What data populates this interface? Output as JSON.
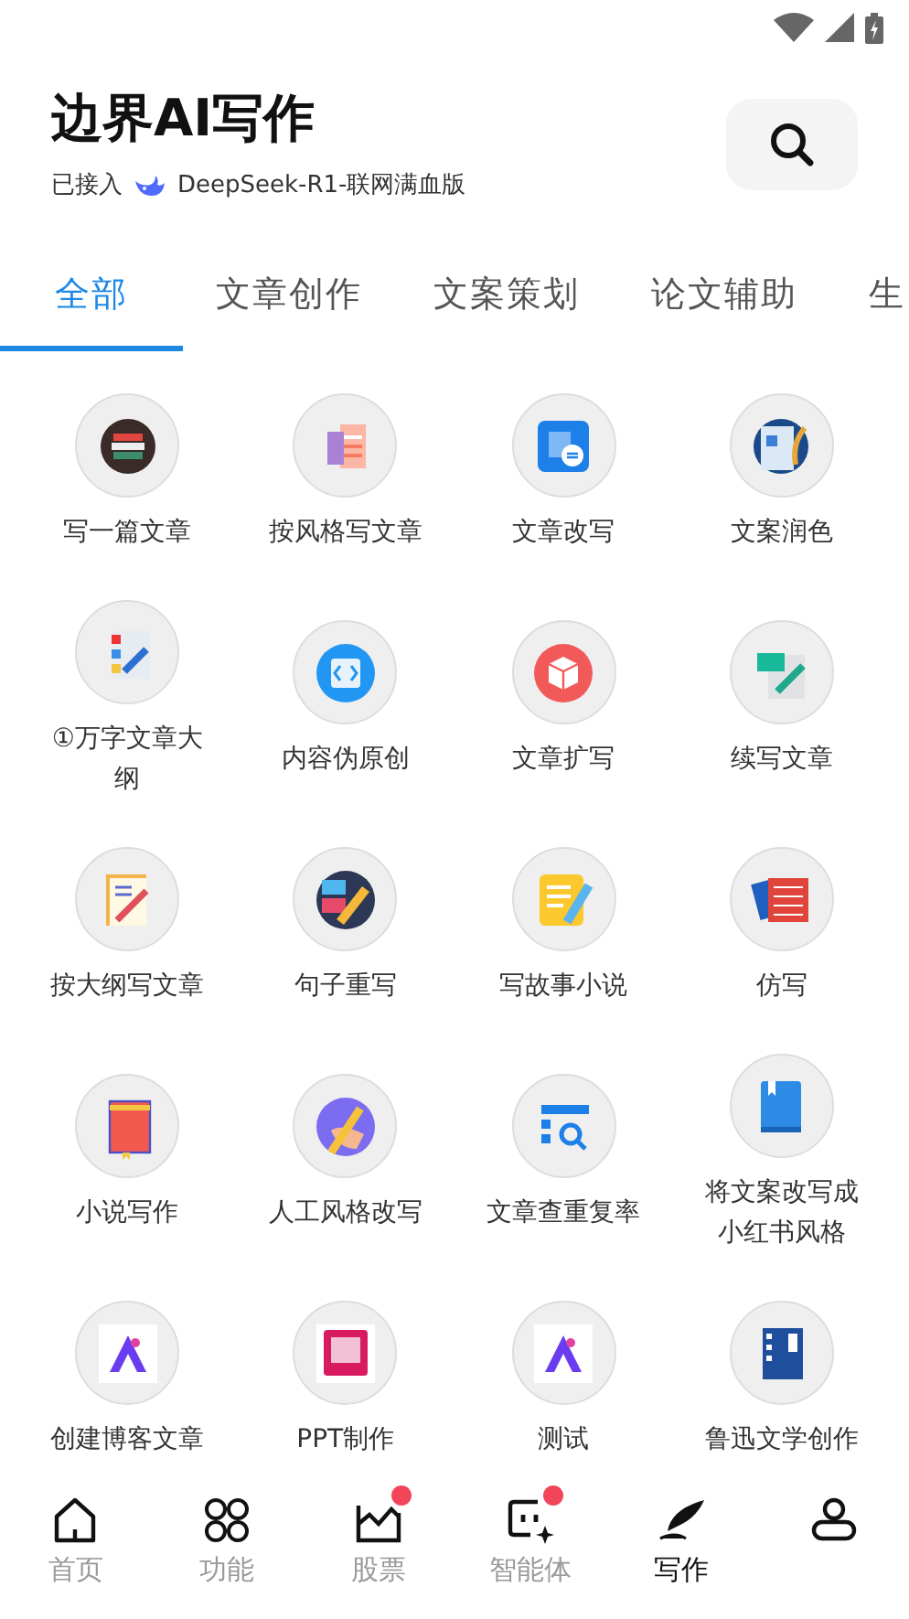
{
  "header": {
    "title": "边界AI写作",
    "connected_label": "已接入",
    "model": "DeepSeek-R1-联网满血版"
  },
  "tabs": [
    {
      "label": "全部",
      "selected": true
    },
    {
      "label": "文章创作",
      "selected": false
    },
    {
      "label": "文案策划",
      "selected": false
    },
    {
      "label": "论文辅助",
      "selected": false
    },
    {
      "label": "生",
      "selected": false
    }
  ],
  "tools": [
    {
      "label": "写一篇文章"
    },
    {
      "label": "按风格写文章"
    },
    {
      "label": "文章改写"
    },
    {
      "label": "文案润色"
    },
    {
      "label": "①万字文章大纲"
    },
    {
      "label": "内容伪原创"
    },
    {
      "label": "文章扩写"
    },
    {
      "label": "续写文章"
    },
    {
      "label": "按大纲写文章"
    },
    {
      "label": "句子重写"
    },
    {
      "label": "写故事小说"
    },
    {
      "label": "仿写"
    },
    {
      "label": "小说写作"
    },
    {
      "label": "人工风格改写"
    },
    {
      "label": "文章查重复率"
    },
    {
      "label": "将文案改写成小红书风格"
    },
    {
      "label": "创建博客文章"
    },
    {
      "label": "PPT制作"
    },
    {
      "label": "测试"
    },
    {
      "label": "鲁迅文学创作"
    }
  ],
  "nav": [
    {
      "label": "首页",
      "selected": false,
      "badge": false
    },
    {
      "label": "功能",
      "selected": false,
      "badge": false
    },
    {
      "label": "股票",
      "selected": false,
      "badge": true
    },
    {
      "label": "智能体",
      "selected": false,
      "badge": true
    },
    {
      "label": "写作",
      "selected": true,
      "badge": false
    },
    {
      "selected": false,
      "badge": false
    }
  ]
}
